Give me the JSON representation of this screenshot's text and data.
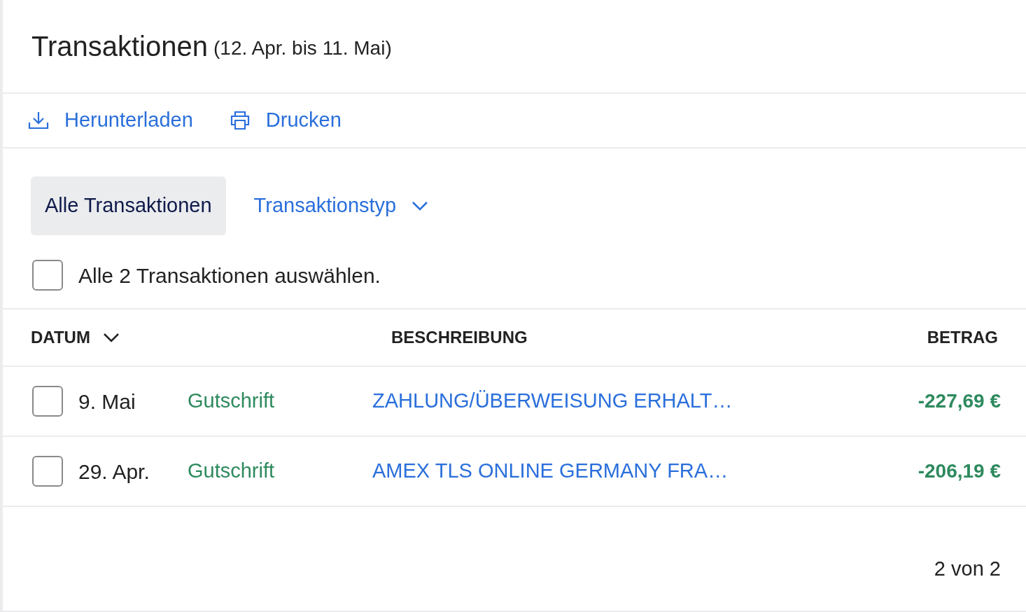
{
  "header": {
    "title": "Transaktionen",
    "period": "(12. Apr. bis 11. Mai)"
  },
  "actions": [
    {
      "kind": "download",
      "label": "Herunterladen"
    },
    {
      "kind": "print",
      "label": "Drucken"
    }
  ],
  "filters": [
    {
      "kind": "tab",
      "label": "Alle Transaktionen",
      "selected": true
    },
    {
      "kind": "dropdown",
      "label": "Transaktionstyp",
      "selected": false
    }
  ],
  "select_all": {
    "label": "Alle 2 Transaktionen auswählen.",
    "checked": false
  },
  "table": {
    "columns": [
      {
        "label": "DATUM",
        "sortable": true
      },
      {
        "label": "BESCHREIBUNG",
        "sortable": false
      },
      {
        "label": "BETRAG",
        "sortable": false
      }
    ],
    "rows": [
      {
        "checked": false,
        "date": "9. Mai",
        "type": "Gutschrift",
        "description": "ZAHLUNG/ÜBERWEISUNG ERHALT…",
        "amount": "-227,69 €"
      },
      {
        "checked": false,
        "date": "29. Apr.",
        "type": "Gutschrift",
        "description": "AMEX TLS ONLINE GERMANY FRA…",
        "amount": "-206,19 €"
      }
    ]
  },
  "pagination": "2 von 2"
}
